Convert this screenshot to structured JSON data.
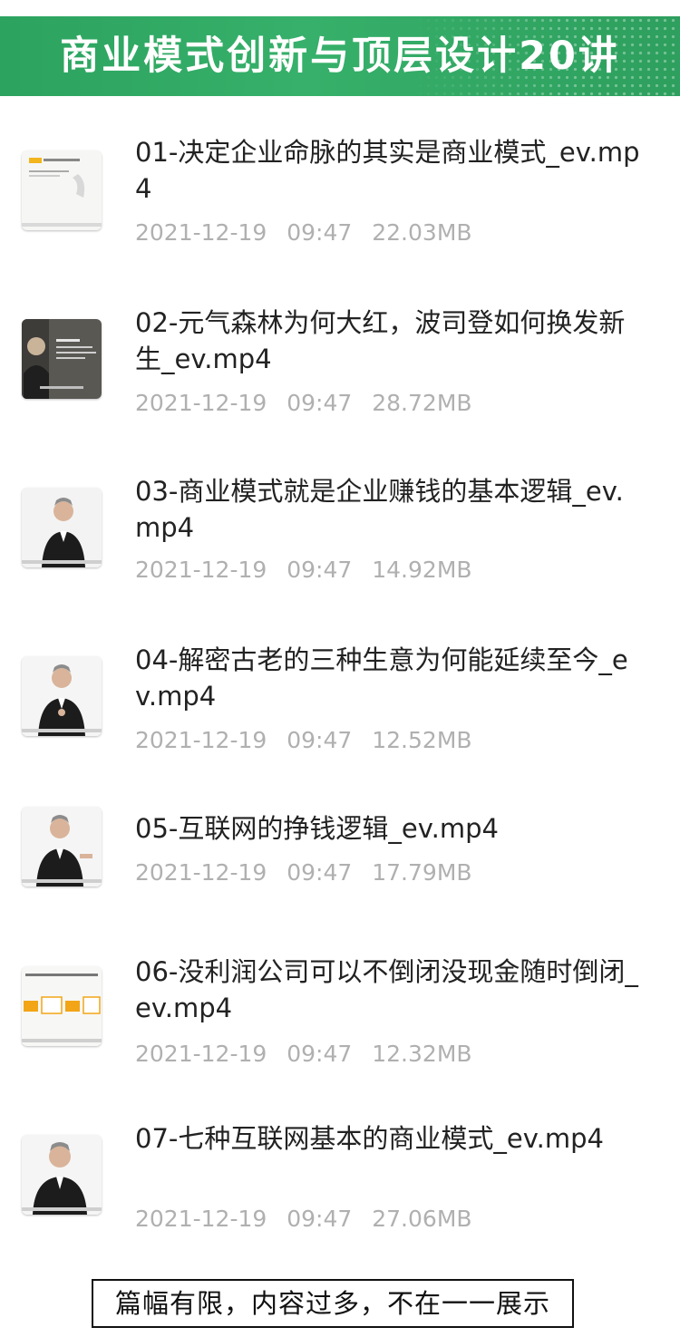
{
  "banner": {
    "title": "商业模式创新与顶层设计20讲",
    "color": "#2ca35f"
  },
  "files": [
    {
      "name": "01-决定企业命脉的其实是商业模式_ev.mp4",
      "date": "2021-12-19",
      "time": "09:47",
      "size": "22.03MB",
      "thumbnail": "slide-thumbnail"
    },
    {
      "name": "02-元气森林为何大红，波司登如何换发新生_ev.mp4",
      "date": "2021-12-19",
      "time": "09:47",
      "size": "28.72MB",
      "thumbnail": "dark-slide-thumbnail"
    },
    {
      "name": "03-商业模式就是企业赚钱的基本逻辑_ev.mp4",
      "date": "2021-12-19",
      "time": "09:47",
      "size": "14.92MB",
      "thumbnail": "presenter-thumbnail"
    },
    {
      "name": "04-解密古老的三种生意为何能延续至今_ev.mp4",
      "date": "2021-12-19",
      "time": "09:47",
      "size": "12.52MB",
      "thumbnail": "presenter-thumbnail"
    },
    {
      "name": "05-互联网的挣钱逻辑_ev.mp4",
      "date": "2021-12-19",
      "time": "09:47",
      "size": "17.79MB",
      "thumbnail": "presenter-thumbnail"
    },
    {
      "name": "06-没利润公司可以不倒闭没现金随时倒闭_ev.mp4",
      "date": "2021-12-19",
      "time": "09:47",
      "size": "12.32MB",
      "thumbnail": "slide-thumbnail"
    },
    {
      "name": "07-七种互联网基本的商业模式_ev.mp4",
      "date": "2021-12-19",
      "time": "09:47",
      "size": "27.06MB",
      "thumbnail": "presenter-thumbnail"
    }
  ],
  "notice": "篇幅有限，内容过多，不在一一展示"
}
